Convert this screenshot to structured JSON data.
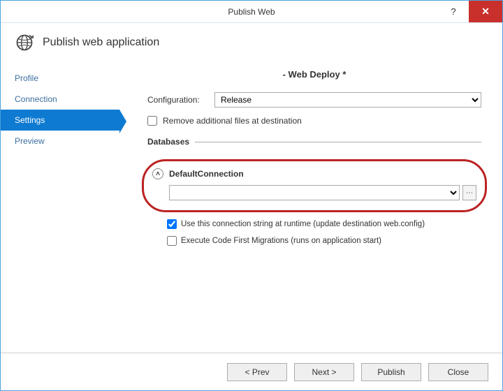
{
  "window": {
    "title": "Publish Web"
  },
  "header": {
    "title": "Publish web application"
  },
  "sidebar": {
    "items": [
      {
        "label": "Profile"
      },
      {
        "label": "Connection"
      },
      {
        "label": "Settings"
      },
      {
        "label": "Preview"
      }
    ],
    "active_index": 2
  },
  "main": {
    "heading": "- Web Deploy *",
    "config_label": "Configuration:",
    "config_options": [
      "Release"
    ],
    "config_value": "Release",
    "remove_files_label": "Remove additional files at destination",
    "remove_files_checked": false,
    "databases_title": "Databases",
    "connection": {
      "name": "DefaultConnection",
      "value": "",
      "use_runtime_label": "Use this connection string at runtime (update destination web.config)",
      "use_runtime_checked": true,
      "code_first_label": "Execute Code First Migrations (runs on application start)",
      "code_first_checked": false
    }
  },
  "footer": {
    "prev": "< Prev",
    "next": "Next >",
    "publish": "Publish",
    "close": "Close"
  }
}
